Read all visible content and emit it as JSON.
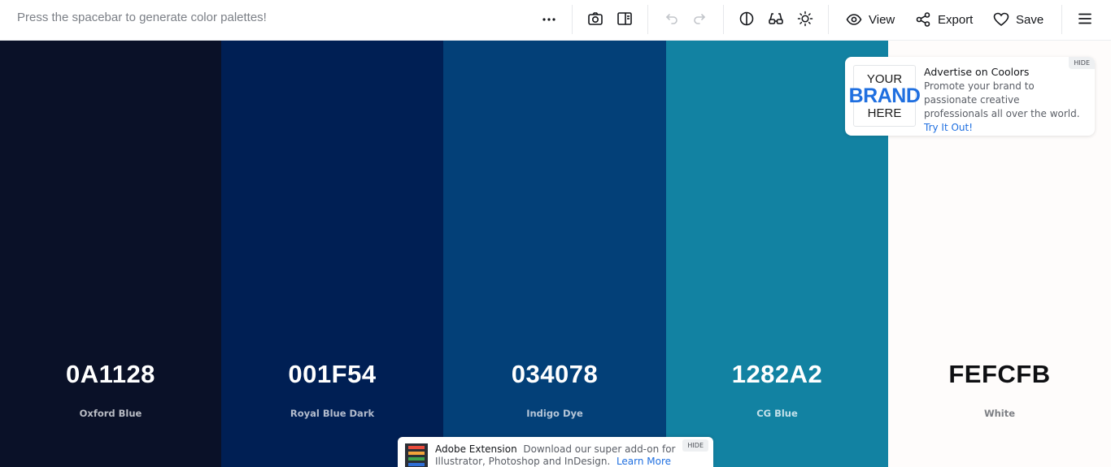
{
  "toolbar": {
    "hint": "Press the spacebar to generate color palettes!",
    "view_label": "View",
    "export_label": "Export",
    "save_label": "Save",
    "icons": [
      "more-icon",
      "camera-icon",
      "sidebar-icon",
      "undo-icon",
      "redo-icon",
      "contrast-icon",
      "glasses-icon",
      "brightness-icon",
      "eye-icon",
      "share-icon",
      "heart-icon",
      "menu-icon"
    ]
  },
  "palette": [
    {
      "hex": "0A1128",
      "name": "Oxford Blue",
      "color": "#0A1128",
      "text_color": "#ffffff",
      "name_color": "#b9bcc4"
    },
    {
      "hex": "001F54",
      "name": "Royal Blue Dark",
      "color": "#001F54",
      "text_color": "#ffffff",
      "name_color": "#b3bccd"
    },
    {
      "hex": "034078",
      "name": "Indigo Dye",
      "color": "#034078",
      "text_color": "#ffffff",
      "name_color": "#b6c6d8"
    },
    {
      "hex": "1282A2",
      "name": "CG Blue",
      "color": "#1282A2",
      "text_color": "#ffffff",
      "name_color": "#c4e1ea"
    },
    {
      "hex": "FEFCFB",
      "name": "White",
      "color": "#FEFCFB",
      "text_color": "#0e0f12",
      "name_color": "#7d7f84"
    }
  ],
  "ad": {
    "logo_line1": "YOUR",
    "logo_line2": "BRAND",
    "logo_line3": "HERE",
    "title": "Advertise on Coolors",
    "body": "Promote your brand to passionate creative professionals all over the world.",
    "link": "Try It Out!",
    "hide": "HIDE"
  },
  "bottom_ad": {
    "title": "Adobe Extension",
    "body": "Download our super add-on for Illustrator, Photoshop and InDesign.",
    "link": "Learn More",
    "hide": "HIDE"
  },
  "colors": {
    "accent": "#1f6fe0",
    "toolbar_icon": "#14161a",
    "disabled_icon": "#c2c5ca"
  }
}
